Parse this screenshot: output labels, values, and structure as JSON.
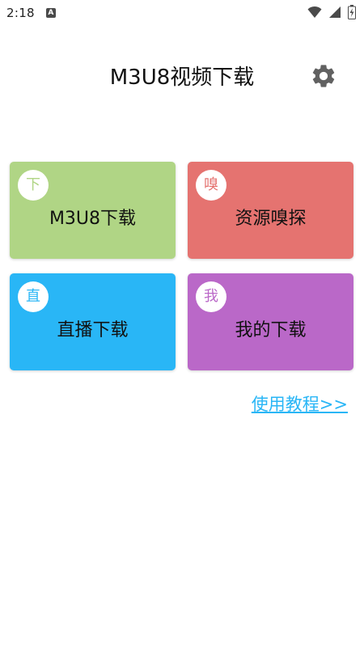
{
  "status_bar": {
    "time": "2:18",
    "notification_icon": "a-letter-icon",
    "icons": [
      "wifi-icon",
      "signal-icon",
      "battery-icon"
    ]
  },
  "header": {
    "title": "M3U8视频下载",
    "settings_icon": "gear-icon"
  },
  "tiles": [
    {
      "badge": "下",
      "label": "M3U8下载",
      "color": "#b0d585",
      "badge_color": "#b0d585"
    },
    {
      "badge": "嗅",
      "label": "资源嗅探",
      "color": "#e57370",
      "badge_color": "#e57370"
    },
    {
      "badge": "直",
      "label": "直播下载",
      "color": "#29b6f6",
      "badge_color": "#29b6f6"
    },
    {
      "badge": "我",
      "label": "我的下载",
      "color": "#ba68c8",
      "badge_color": "#ba68c8"
    }
  ],
  "tutorial_link": {
    "label": "使用教程>>",
    "color": "#29b6f6"
  },
  "colors": {
    "icon_gray": "#616161",
    "status_icon": "#4a4a4a"
  }
}
